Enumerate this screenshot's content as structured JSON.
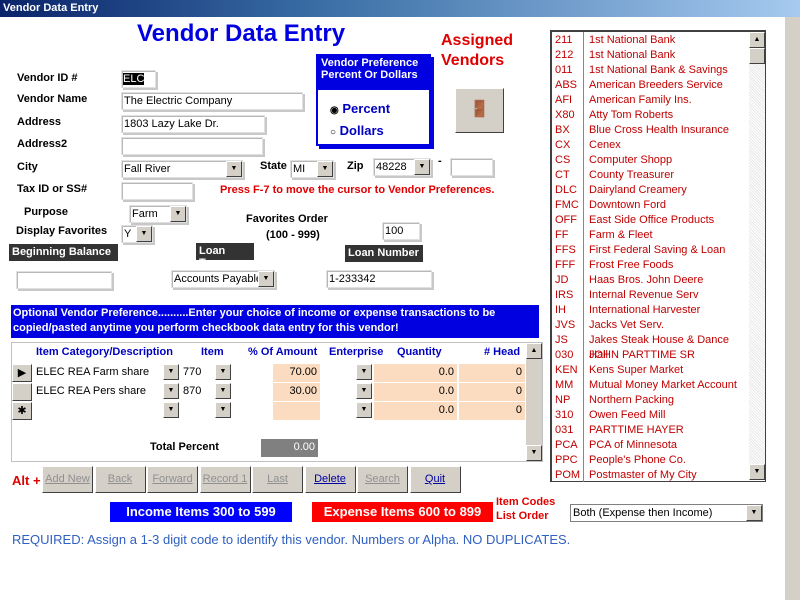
{
  "window": {
    "title": "Vendor Data Entry"
  },
  "header": {
    "title": "Vendor Data Entry",
    "assigned": "Assigned",
    "vendors": "Vendors"
  },
  "form": {
    "vendor_id_label": "Vendor ID #",
    "vendor_id": "ELC",
    "vendor_name_label": "Vendor Name",
    "vendor_name": "The Electric Company",
    "address_label": "Address",
    "address": "1803 Lazy Lake Dr.",
    "address2_label": "Address2",
    "address2": "",
    "city_label": "City",
    "city": "Fall River",
    "state_label": "State",
    "state": "MI",
    "zip_label": "Zip",
    "zip": "48228",
    "zip_dash": "-",
    "zip_ext": "",
    "taxid_label": "Tax ID or SS#",
    "taxid": "",
    "f7_hint": "Press F-7 to move the cursor to Vendor Preferences.",
    "purpose_label": "Purpose",
    "purpose": "Farm",
    "display_fav_label": "Display Favorites",
    "display_fav": "Y",
    "fav_order_label": "Favorites Order",
    "fav_order_range": "(100 - 999)",
    "fav_order": "100",
    "beg_balance_label": "Beginning Balance",
    "beg_balance": "",
    "loan_type_label": "Loan Type",
    "loan_type": "Accounts Payable",
    "loan_number_label": "Loan Number",
    "loan_number": "1-233342"
  },
  "preference": {
    "title_line1": "Vendor Preference",
    "title_line2": "Percent Or Dollars",
    "options": [
      "Percent",
      "Dollars"
    ],
    "selected": "Percent"
  },
  "exit_button": {
    "icon": "door-exit-icon"
  },
  "optional": {
    "line1": "Optional Vendor Preference..........Enter your choice of income or expense transactions to be",
    "line2": "copied/pasted anytime you perform checkbook data entry for this vendor!"
  },
  "grid": {
    "columns": [
      "Item Category/Description",
      "Item",
      "% Of Amount",
      "Enterprise",
      "Quantity",
      "# Head"
    ],
    "rows": [
      {
        "selector": "▶",
        "category": "ELEC REA Farm share",
        "item": "770",
        "percent": "70.00",
        "enterprise": "",
        "quantity": "0.0",
        "head": "0"
      },
      {
        "selector": "",
        "category": "ELEC REA Pers share",
        "item": "870",
        "percent": "30.00",
        "enterprise": "",
        "quantity": "0.0",
        "head": "0"
      },
      {
        "selector": "✱",
        "category": "",
        "item": "",
        "percent": "",
        "enterprise": "",
        "quantity": "0.0",
        "head": "0"
      }
    ],
    "total_label": "Total Percent",
    "total": "0.00"
  },
  "nav": {
    "alt_label": "Alt +",
    "buttons": [
      {
        "label": "Add New",
        "enabled": false
      },
      {
        "label": "Back",
        "enabled": false
      },
      {
        "label": "Forward",
        "enabled": false
      },
      {
        "label": "Record 1",
        "enabled": false
      },
      {
        "label": "Last",
        "enabled": false
      },
      {
        "label": "Delete",
        "enabled": true
      },
      {
        "label": "Search",
        "enabled": false
      },
      {
        "label": "Quit",
        "enabled": true
      }
    ]
  },
  "legend": {
    "income": "Income Items 300 to 599",
    "expense": "Expense Items 600 to 899",
    "item_codes_line1": "Item Codes",
    "item_codes_line2": "List Order",
    "list_order": "Both (Expense then Income)"
  },
  "footer": {
    "required": "REQUIRED: Assign a 1-3 digit code to identify this vendor. Numbers or Alpha. NO DUPLICATES."
  },
  "colors": {
    "blue": "#0000ff",
    "red": "#ff0000",
    "dark_red": "#c00000",
    "peach": "#fbdcc0"
  },
  "vendors": [
    [
      "211",
      "1st National Bank"
    ],
    [
      "212",
      "1st National Bank"
    ],
    [
      "011",
      "1st National Bank & Savings"
    ],
    [
      "ABS",
      "American Breeders Service"
    ],
    [
      "AFI",
      "American Family Ins."
    ],
    [
      "X80",
      "Atty Tom Roberts"
    ],
    [
      "BX",
      "Blue Cross Health Insurance"
    ],
    [
      "CX",
      "Cenex"
    ],
    [
      "CS",
      "Computer Shopp"
    ],
    [
      "CT",
      "County Treasurer"
    ],
    [
      "DLC",
      "Dairyland Creamery"
    ],
    [
      "FMC",
      "Downtown Ford"
    ],
    [
      "OFF",
      "East Side Office Products"
    ],
    [
      "FF",
      "Farm & Fleet"
    ],
    [
      "FFS",
      "First Federal Saving & Loan"
    ],
    [
      "FFF",
      "Frost Free Foods"
    ],
    [
      "JD",
      "Haas Bros. John Deere"
    ],
    [
      "IRS",
      "Internal Revenue Serv"
    ],
    [
      "IH",
      "International Harvester"
    ],
    [
      "JVS",
      "Jacks Vet Serv."
    ],
    [
      "JS",
      "Jakes Steak House & Dance Hall"
    ],
    [
      "030",
      "JOHN PARTTIME SR"
    ],
    [
      "KEN",
      "Kens Super Market"
    ],
    [
      "MM",
      "Mutual Money Market Account"
    ],
    [
      "NP",
      "Northern Packing"
    ],
    [
      "310",
      "Owen Feed Mill"
    ],
    [
      "031",
      "PARTTIME HAYER"
    ],
    [
      "PCA",
      "PCA of Minnesota"
    ],
    [
      "PPC",
      "People's Phone Co."
    ],
    [
      "POM",
      "Postmaster of My City"
    ]
  ]
}
